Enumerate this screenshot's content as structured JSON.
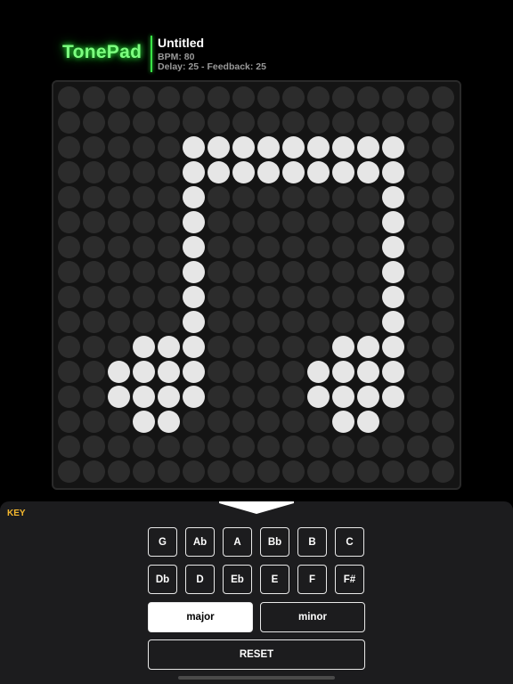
{
  "header": {
    "logo": "TonePad",
    "song_title": "Untitled",
    "bpm_text": "BPM: 80",
    "effects_text": "Delay: 25 - Feedback: 25"
  },
  "grid": {
    "rows": 16,
    "cols": 16,
    "on_color": "#e6e6e6",
    "off_color": "#2c2c2c",
    "active": [
      [
        2,
        5
      ],
      [
        2,
        6
      ],
      [
        2,
        7
      ],
      [
        2,
        8
      ],
      [
        2,
        9
      ],
      [
        2,
        10
      ],
      [
        2,
        11
      ],
      [
        2,
        12
      ],
      [
        2,
        13
      ],
      [
        3,
        5
      ],
      [
        3,
        6
      ],
      [
        3,
        7
      ],
      [
        3,
        8
      ],
      [
        3,
        9
      ],
      [
        3,
        10
      ],
      [
        3,
        11
      ],
      [
        3,
        12
      ],
      [
        3,
        13
      ],
      [
        4,
        5
      ],
      [
        4,
        13
      ],
      [
        5,
        5
      ],
      [
        5,
        13
      ],
      [
        6,
        5
      ],
      [
        6,
        13
      ],
      [
        7,
        5
      ],
      [
        7,
        13
      ],
      [
        8,
        5
      ],
      [
        8,
        13
      ],
      [
        9,
        5
      ],
      [
        9,
        13
      ],
      [
        10,
        3
      ],
      [
        10,
        4
      ],
      [
        10,
        5
      ],
      [
        10,
        11
      ],
      [
        10,
        12
      ],
      [
        10,
        13
      ],
      [
        11,
        2
      ],
      [
        11,
        3
      ],
      [
        11,
        4
      ],
      [
        11,
        5
      ],
      [
        11,
        10
      ],
      [
        11,
        11
      ],
      [
        11,
        12
      ],
      [
        11,
        13
      ],
      [
        12,
        2
      ],
      [
        12,
        3
      ],
      [
        12,
        4
      ],
      [
        12,
        5
      ],
      [
        12,
        10
      ],
      [
        12,
        11
      ],
      [
        12,
        12
      ],
      [
        12,
        13
      ],
      [
        13,
        3
      ],
      [
        13,
        4
      ],
      [
        13,
        11
      ],
      [
        13,
        12
      ]
    ]
  },
  "panel": {
    "key_label": "KEY",
    "collapse_icon": "chevron-down-icon",
    "notes_row1": [
      "G",
      "Ab",
      "A",
      "Bb",
      "B",
      "C"
    ],
    "notes_row2": [
      "Db",
      "D",
      "Eb",
      "E",
      "F",
      "F#"
    ],
    "scale_major": "major",
    "scale_minor": "minor",
    "selected_scale": "major",
    "reset_label": "RESET"
  },
  "colors": {
    "brand_green": "#7dff80",
    "key_label": "#f5b82e",
    "panel_bg": "#1c1c1e"
  }
}
